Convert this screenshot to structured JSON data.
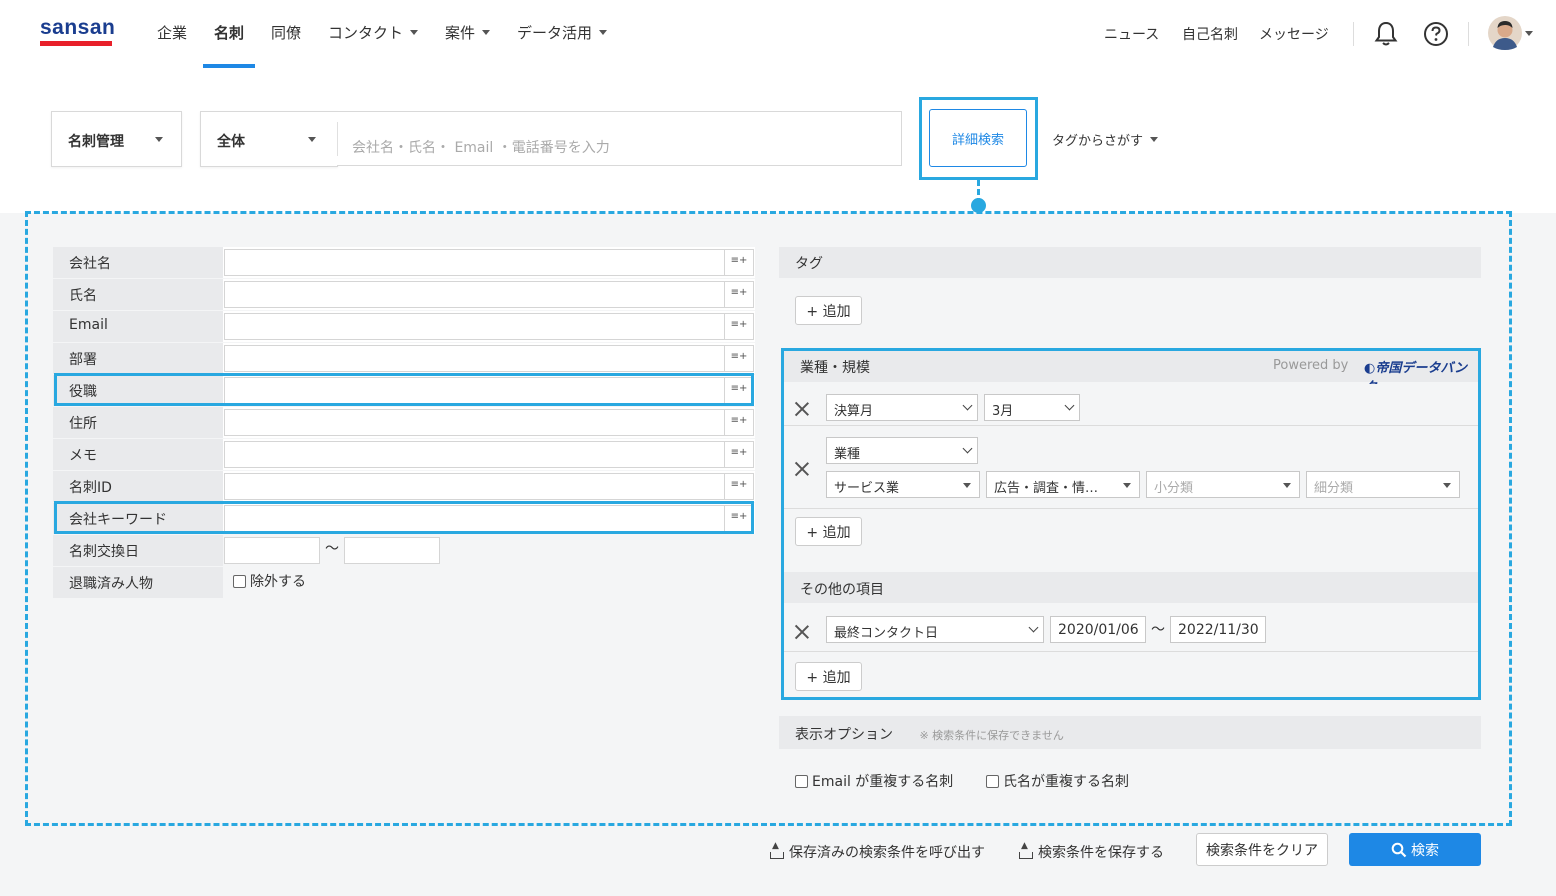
{
  "header": {
    "logo": "sansan",
    "nav": [
      {
        "label": "企業",
        "dropdown": false,
        "active": false
      },
      {
        "label": "名刺",
        "dropdown": false,
        "active": true
      },
      {
        "label": "同僚",
        "dropdown": false,
        "active": false
      },
      {
        "label": "コンタクト",
        "dropdown": true,
        "active": false
      },
      {
        "label": "案件",
        "dropdown": true,
        "active": false
      },
      {
        "label": "データ活用",
        "dropdown": true,
        "active": false
      }
    ],
    "right_links": [
      "ニュース",
      "自己名刺",
      "メッセージ"
    ],
    "icons": [
      "bell-icon",
      "help-icon",
      "avatar"
    ]
  },
  "searchbar": {
    "scope": "名刺管理",
    "range": "全体",
    "placeholder": "会社名・氏名・ Email ・電話番号を入力",
    "advanced_button": "詳細検索",
    "tag_search": "タグからさがす"
  },
  "form": {
    "fields": [
      "会社名",
      "氏名",
      "Email",
      "部署",
      "役職",
      "住所",
      "メモ",
      "名刺ID",
      "会社キーワード"
    ],
    "exchange_date_label": "名刺交換日",
    "date_sep": "〜",
    "retired_label": "退職済み人物",
    "retired_checkbox": "除外する"
  },
  "tag_section": {
    "header": "タグ",
    "add": "+ 追加"
  },
  "industry_section": {
    "header": "業種・規模",
    "powered_by": "Powered by",
    "provider": "帝国データバンク",
    "fiscal_month_select": "決算月",
    "fiscal_month_value": "3月",
    "industry_select": "業種",
    "industry_major": "サービス業",
    "industry_middle": "広告・調査・情…",
    "industry_minor": "小分類",
    "industry_detail": "細分類",
    "add": "+ 追加"
  },
  "other_section": {
    "header": "その他の項目",
    "field_select": "最終コンタクト日",
    "date_from": "2020/01/06",
    "date_sep": "〜",
    "date_to": "2022/11/30",
    "add": "+ 追加"
  },
  "display_options": {
    "header": "表示オプション",
    "note": "※ 検索条件に保存できません",
    "opt_email": "Email が重複する名刺",
    "opt_name": "氏名が重複する名刺"
  },
  "actions": {
    "load_saved": "保存済みの検索条件を呼び出す",
    "save": "検索条件を保存する",
    "clear": "検索条件をクリア",
    "search": "検索"
  },
  "colors": {
    "accent": "#1e88e5",
    "highlight": "#29a8e0",
    "logo_red": "#e8202a",
    "logo_blue": "#1a3d8f"
  }
}
